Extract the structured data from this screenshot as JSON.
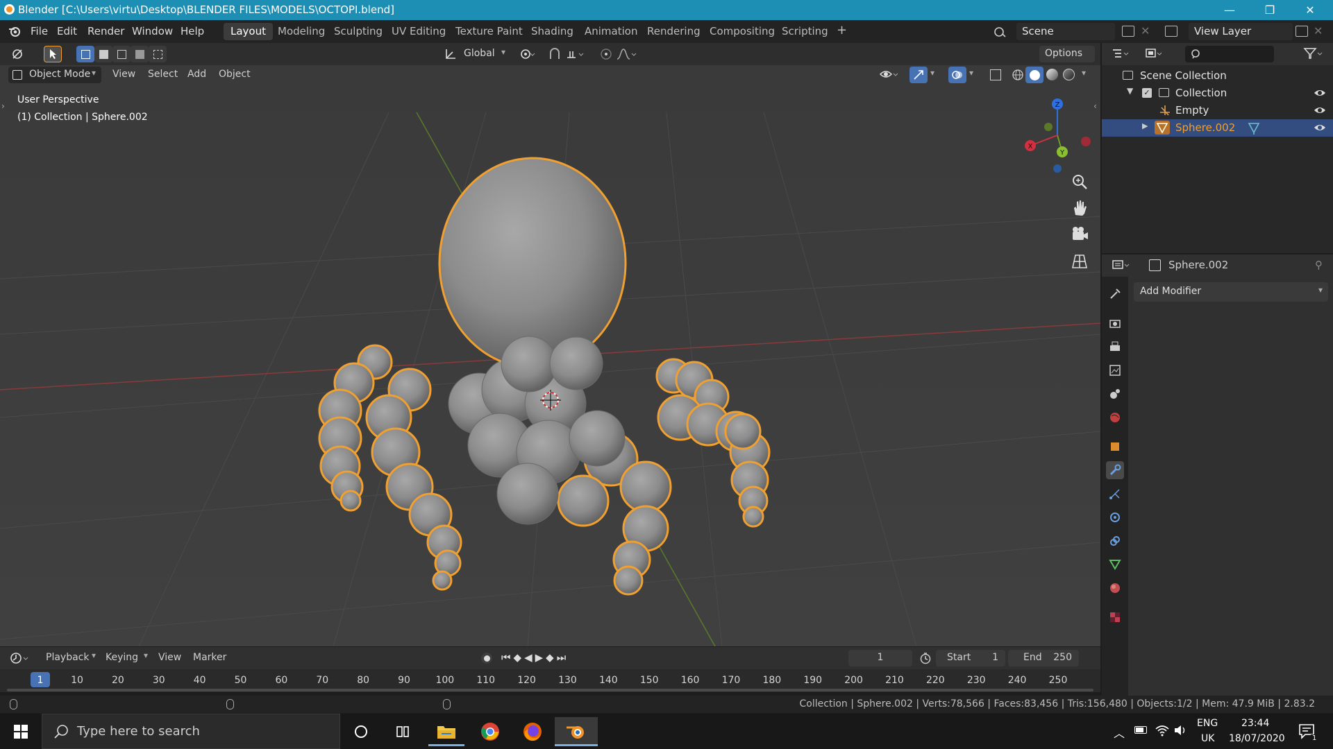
{
  "window": {
    "title": "Blender [C:\\Users\\virtu\\Desktop\\BLENDER FILES\\MODELS\\OCTOPI.blend]",
    "controls": [
      "—",
      "❐",
      "✕"
    ]
  },
  "menubar": {
    "items": [
      "File",
      "Edit",
      "Render",
      "Window",
      "Help"
    ],
    "workspaces": [
      "Layout",
      "Modeling",
      "Sculpting",
      "UV Editing",
      "Texture Paint",
      "Shading",
      "Animation",
      "Rendering",
      "Compositing",
      "Scripting"
    ],
    "add_workspace": "+",
    "scene_label": "Scene",
    "view_layer_label": "View Layer"
  },
  "viewport_header": {
    "orientation": "Global",
    "options": "Options",
    "mode": "Object Mode",
    "menus": [
      "View",
      "Select",
      "Add",
      "Object"
    ]
  },
  "viewport": {
    "perspective": "User Perspective",
    "collection_info": "(1) Collection | Sphere.002",
    "gizmo_axes": [
      "X",
      "Y",
      "Z"
    ]
  },
  "outliner": {
    "root": "Scene Collection",
    "items": [
      {
        "label": "Collection"
      },
      {
        "label": "Empty"
      },
      {
        "label": "Sphere.002"
      }
    ]
  },
  "properties": {
    "object_name": "Sphere.002",
    "add_modifier": "Add Modifier"
  },
  "timeline": {
    "menus": [
      "Playback",
      "Keying",
      "View",
      "Marker"
    ],
    "current_frame": "1",
    "start_label": "Start",
    "start_value": "1",
    "end_label": "End",
    "end_value": "250",
    "ticks": [
      "1",
      "10",
      "20",
      "30",
      "40",
      "50",
      "60",
      "70",
      "80",
      "90",
      "100",
      "110",
      "120",
      "130",
      "140",
      "150",
      "160",
      "170",
      "180",
      "190",
      "200",
      "210",
      "220",
      "230",
      "240",
      "250"
    ]
  },
  "statusbar": {
    "stats": "Collection | Sphere.002 | Verts:78,566 | Faces:83,456 | Tris:156,480 | Objects:1/2 | Mem: 47.9 MiB | 2.83.2"
  },
  "taskbar": {
    "search_placeholder": "Type here to search",
    "lang_top": "ENG",
    "lang_bottom": "UK",
    "time": "23:44",
    "date": "18/07/2020",
    "notification_count": "1"
  },
  "colors": {
    "titlebar": "#1e8fb4",
    "selection_outline": "#f0a030",
    "selected_row": "#334d80",
    "viewport_bg": "#3d3d3d"
  }
}
